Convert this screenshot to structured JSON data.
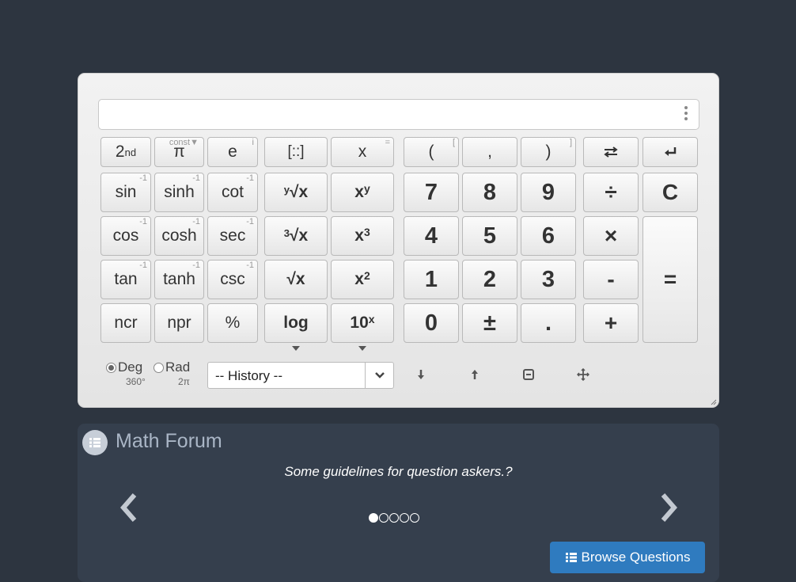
{
  "display": {
    "value": ""
  },
  "keys": {
    "second": {
      "base": "2",
      "sup": "nd"
    },
    "pi": {
      "label": "π",
      "hint": "const▼"
    },
    "e": {
      "label": "e",
      "hint": "i"
    },
    "matrix": {
      "label": "[::]"
    },
    "x": {
      "label": "x",
      "hint": "="
    },
    "lparen": {
      "label": "(",
      "hint": "["
    },
    "comma": {
      "label": ","
    },
    "rparen": {
      "label": ")",
      "hint": "]"
    },
    "sin": {
      "label": "sin",
      "hint": "-1"
    },
    "sinh": {
      "label": "sinh",
      "hint": "-1"
    },
    "cot": {
      "label": "cot",
      "hint": "-1"
    },
    "yroot": {
      "pre": "y",
      "label": "√x"
    },
    "xpowy": {
      "base": "x",
      "sup": "y"
    },
    "cos": {
      "label": "cos",
      "hint": "-1"
    },
    "cosh": {
      "label": "cosh",
      "hint": "-1"
    },
    "sec": {
      "label": "sec",
      "hint": "-1"
    },
    "cuberoot": {
      "pre": "3",
      "label": "√x"
    },
    "xcube": {
      "base": "x",
      "sup": "3"
    },
    "tan": {
      "label": "tan",
      "hint": "-1"
    },
    "tanh": {
      "label": "tanh",
      "hint": "-1"
    },
    "csc": {
      "label": "csc",
      "hint": "-1"
    },
    "sqrt": {
      "label": "√x"
    },
    "xsq": {
      "base": "x",
      "sup": "2"
    },
    "ncr": {
      "label": "ncr"
    },
    "npr": {
      "label": "npr"
    },
    "percent": {
      "label": "%"
    },
    "log": {
      "label": "log"
    },
    "tenpow": {
      "base": "10",
      "sup": "x"
    },
    "n7": "7",
    "n8": "8",
    "n9": "9",
    "n4": "4",
    "n5": "5",
    "n6": "6",
    "n1": "1",
    "n2": "2",
    "n3": "3",
    "n0": "0",
    "plusminus": "±",
    "dot": ".",
    "divide": "÷",
    "multiply": "×",
    "minus": "-",
    "plus": "+",
    "clear": "C",
    "equals": "="
  },
  "angle": {
    "deg_label": "Deg",
    "deg_sub": "360°",
    "rad_label": "Rad",
    "rad_sub": "2π",
    "selected": "Deg"
  },
  "history": {
    "selected": "-- History --"
  },
  "forum": {
    "title": "Math Forum",
    "question": "Some guidelines for question askers.?",
    "slides": 5,
    "active_slide": 1,
    "browse_label": "Browse Questions"
  },
  "colors": {
    "background": "#2d3540",
    "forum_panel": "#353f4d",
    "accent": "#2f7bbf"
  }
}
